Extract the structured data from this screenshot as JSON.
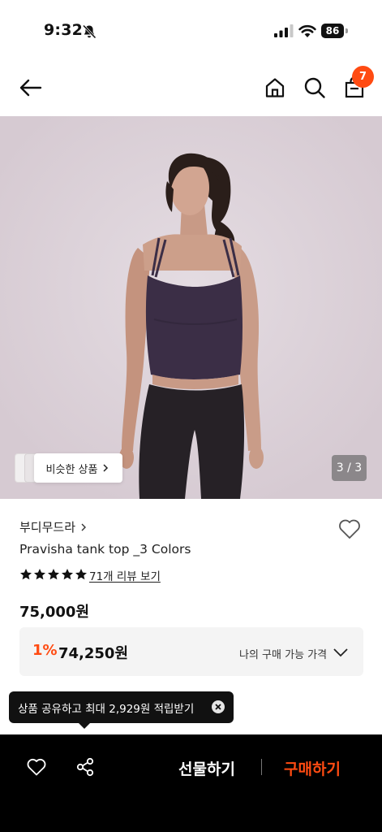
{
  "status_bar": {
    "time": "9:32",
    "battery": "86"
  },
  "header": {
    "cart_count": "7"
  },
  "hero": {
    "similar_label": "비슷한 상품",
    "page_counter": "3 / 3"
  },
  "product": {
    "brand": "부디무드라",
    "name": "Pravisha tank top _3 Colors",
    "rating_stars": 5,
    "review_link": "71개 리뷰 보기",
    "price": "75,000원"
  },
  "benefit": {
    "discount_rate": "1%",
    "price": "74,250원",
    "label": "나의 구매 가능 가격"
  },
  "tooltip": {
    "text": "상품 공유하고 최대 2,929원 적립받기"
  },
  "bottom_bar": {
    "gift_label": "선물하기",
    "buy_label": "구매하기"
  },
  "colors": {
    "accent": "#ff4b12",
    "hero_bg": "#ddd3d9",
    "top_color": "#3b2e46"
  },
  "icons": [
    "bell-off-icon",
    "signal-icon",
    "wifi-icon",
    "battery-icon",
    "back-arrow-icon",
    "home-icon",
    "search-icon",
    "bag-icon",
    "chevron-right-icon",
    "heart-icon",
    "star-icon",
    "chevron-down-icon",
    "close-circle-icon",
    "share-icon"
  ]
}
